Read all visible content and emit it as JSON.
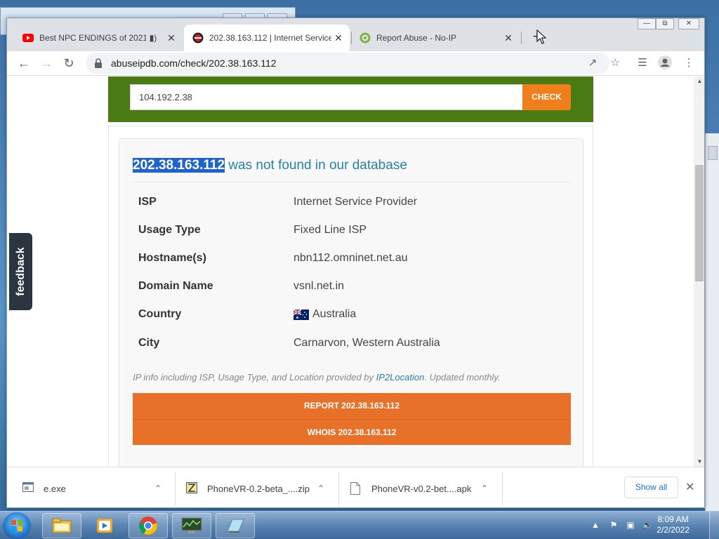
{
  "browser": {
    "tabs": [
      {
        "title": "Best NPC ENDINGS of 2021",
        "favicon": "youtube-icon",
        "audio": true
      },
      {
        "title": "202.38.163.112 | Internet Service",
        "favicon": "abuseipdb-icon",
        "active": true
      },
      {
        "title": "Report Abuse - No-IP",
        "favicon": "noip-icon"
      }
    ],
    "url": "abuseipdb.com/check/202.38.163.112"
  },
  "search": {
    "value": "104.192.2.38",
    "button_label": "CHECK"
  },
  "result": {
    "ip": "202.38.163.112",
    "heading_suffix": " was not found in our database",
    "rows": [
      {
        "key": "ISP",
        "value": "Internet Service Provider"
      },
      {
        "key": "Usage Type",
        "value": "Fixed Line ISP"
      },
      {
        "key": "Hostname(s)",
        "value": "nbn112.omninet.net.au"
      },
      {
        "key": "Domain Name",
        "value": "vsnl.net.in"
      },
      {
        "key": "Country",
        "value": "Australia",
        "flag": "australia-flag"
      },
      {
        "key": "City",
        "value": "Carnarvon, Western Australia"
      }
    ],
    "attribution_prefix": "IP info including ISP, Usage Type, and Location provided by ",
    "attribution_link": "IP2Location",
    "attribution_suffix": ". Updated monthly.",
    "report_label": "REPORT 202.38.163.112",
    "whois_label": "WHOIS 202.38.163.112"
  },
  "feedback_label": "feedback",
  "downloads": {
    "items": [
      {
        "name": "e.exe",
        "icon": "exe-file-icon"
      },
      {
        "name": "PhoneVR-0.2-beta_....zip",
        "icon": "zip-file-icon"
      },
      {
        "name": "PhoneVR-v0.2-bet....apk",
        "icon": "file-icon"
      }
    ],
    "show_all": "Show all"
  },
  "taskbar": {
    "time": "8:09 AM",
    "date": "2/2/2022"
  },
  "colors": {
    "search_band": "#4a7a12",
    "check_button": "#f07f1b",
    "action_button": "#e8712a",
    "heading": "#2a7fa8",
    "selection": "#1e63d2"
  }
}
